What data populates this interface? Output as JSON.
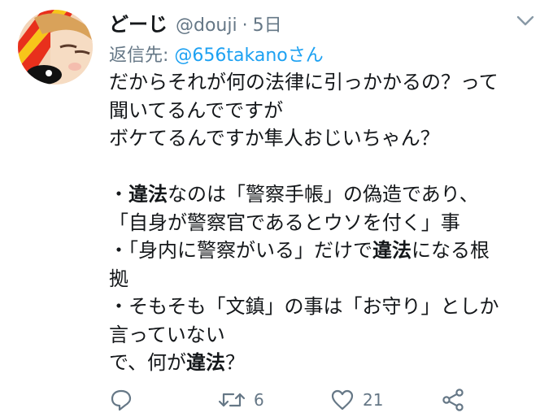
{
  "header": {
    "display_name": "どーじ",
    "handle": "@douji",
    "separator": "·",
    "time": "5日"
  },
  "reply": {
    "prefix": "返信先:",
    "mention": "@656takano",
    "suffix": "さん"
  },
  "tweet": {
    "line1": "だからそれが何の法律に引っかかるの？って",
    "line2": "聞いてるんでですが",
    "line3": "ボケてるんですか隼人おじいちゃん？",
    "line5a": "・",
    "line5b": "違法",
    "line5c": "なのは「警察手帳」の偽造であり、",
    "line6": "「自身が警察官であるとウソを付く」事",
    "line7a": "・「身内に警察がいる」だけで",
    "line7b": "違法",
    "line7c": "になる根",
    "line8": "拠",
    "line9": "・そもそも「文鎮」の事は「お守り」としか",
    "line10": "言っていない",
    "line11a": "で、何が",
    "line11b": "違法",
    "line11c": "？"
  },
  "actions": {
    "reply_icon": "reply-icon",
    "retweet_icon": "retweet-icon",
    "retweet_count": "6",
    "like_icon": "heart-icon",
    "like_count": "21",
    "share_icon": "share-icon"
  },
  "colors": {
    "text": "#14171a",
    "secondary": "#657786",
    "link": "#1da1f2"
  }
}
